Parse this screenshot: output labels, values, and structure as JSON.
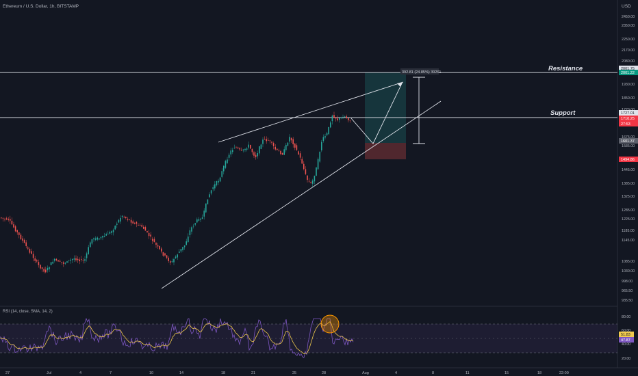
{
  "header": {
    "symbol_title": "Ethereum / U.S. Dollar, 1h, BITSTAMP",
    "currency": "USD"
  },
  "price_axis": {
    "ticks": [
      "2450.00",
      "2350.00",
      "2250.00",
      "2170.00",
      "2080.00",
      "1930.00",
      "1850.00",
      "1770.00",
      "1675.00",
      "1585.00",
      "1445.00",
      "1385.00",
      "1325.00",
      "1285.00",
      "1225.00",
      "1185.00",
      "1145.00",
      "1085.00",
      "1030.00",
      "998.00",
      "965.50",
      "935.50"
    ],
    "tags": [
      {
        "text": "2001.75",
        "style": "white"
      },
      {
        "text": "2001.22",
        "style": "green"
      },
      {
        "text": "1727.01",
        "style": "white"
      },
      {
        "text": "1710.25",
        "style": "red"
      },
      {
        "text": "27:53",
        "style": "red"
      },
      {
        "text": "1601.37",
        "style": "gray"
      },
      {
        "text": "1494.86",
        "style": "red"
      }
    ]
  },
  "annotations": {
    "resistance": "Resistance",
    "support": "Support",
    "measure": "392.81 (24.85%) 39261"
  },
  "rsi": {
    "title": "RSI (14, close, SMA, 14, 2)",
    "ticks": [
      "80.00",
      "60.00",
      "40.00",
      "20.00"
    ],
    "tags": [
      {
        "text": "51.83",
        "style": "yellow"
      },
      {
        "text": "47.87",
        "style": "purple"
      }
    ]
  },
  "time_axis": {
    "labels": [
      "27",
      "Jul",
      "4",
      "7",
      "10",
      "14",
      "18",
      "21",
      "25",
      "28",
      "Aug",
      "4",
      "8",
      "11",
      "15",
      "18",
      "22:00"
    ]
  },
  "colors": {
    "background": "#131722",
    "up": "#26a69a",
    "down": "#ef5350",
    "rsi_line": "#7e57c2",
    "rsi_sma": "#f0c94d"
  }
}
